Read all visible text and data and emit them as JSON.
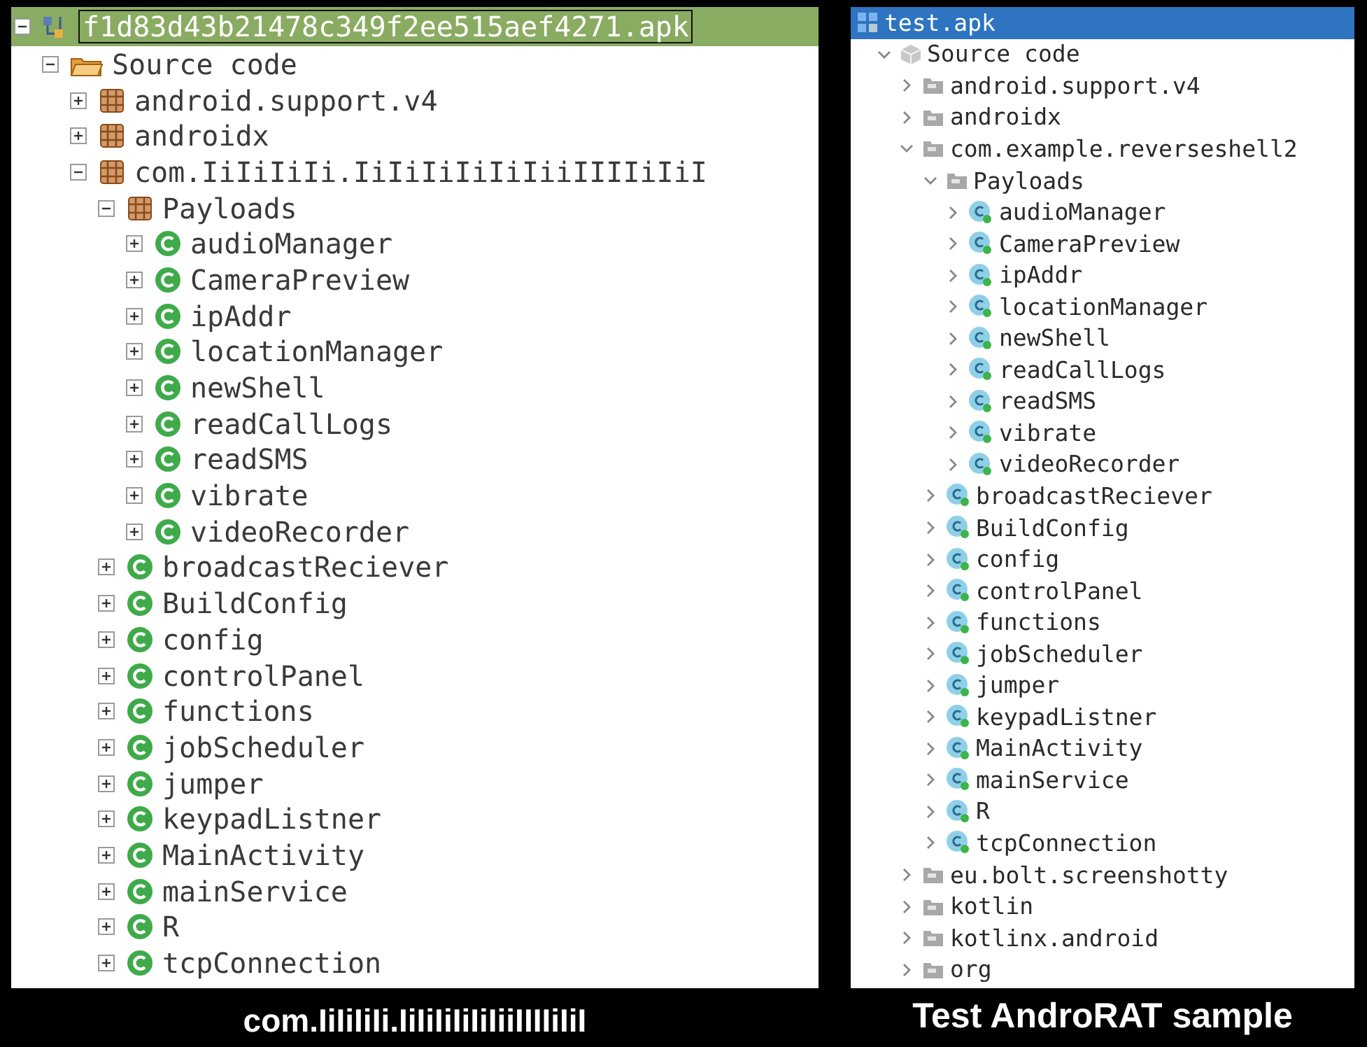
{
  "panels": [
    {
      "kind": "classic",
      "caption": "com.IiIiIiIi.IiIiIiIiIiIiiIIIIiIiI",
      "root": {
        "label": "f1d83d43b21478c349f2ee515aef4271.apk",
        "kind": "apk",
        "selected": true,
        "expanded": true,
        "children": [
          {
            "label": "Source code",
            "kind": "source",
            "selected": false,
            "expanded": true,
            "children": [
              {
                "label": "android.support.v4",
                "kind": "package",
                "selected": false,
                "expanded": false
              },
              {
                "label": "androidx",
                "kind": "package",
                "selected": false,
                "expanded": false
              },
              {
                "label": "com.IiIiIiIi.IiIiIiIiIiIiiIIIIiIiI",
                "kind": "package",
                "selected": false,
                "expanded": true,
                "children": [
                  {
                    "label": "Payloads",
                    "kind": "package",
                    "selected": false,
                    "expanded": true,
                    "children": [
                      {
                        "label": "audioManager",
                        "kind": "class",
                        "selected": false,
                        "expanded": false
                      },
                      {
                        "label": "CameraPreview",
                        "kind": "class",
                        "selected": false,
                        "expanded": false
                      },
                      {
                        "label": "ipAddr",
                        "kind": "class",
                        "selected": false,
                        "expanded": false
                      },
                      {
                        "label": "locationManager",
                        "kind": "class",
                        "selected": false,
                        "expanded": false
                      },
                      {
                        "label": "newShell",
                        "kind": "class",
                        "selected": false,
                        "expanded": false
                      },
                      {
                        "label": "readCallLogs",
                        "kind": "class",
                        "selected": false,
                        "expanded": false
                      },
                      {
                        "label": "readSMS",
                        "kind": "class",
                        "selected": false,
                        "expanded": false
                      },
                      {
                        "label": "vibrate",
                        "kind": "class",
                        "selected": false,
                        "expanded": false
                      },
                      {
                        "label": "videoRecorder",
                        "kind": "class",
                        "selected": false,
                        "expanded": false
                      }
                    ]
                  },
                  {
                    "label": "broadcastReciever",
                    "kind": "class",
                    "selected": false,
                    "expanded": false
                  },
                  {
                    "label": "BuildConfig",
                    "kind": "class",
                    "selected": false,
                    "expanded": false
                  },
                  {
                    "label": "config",
                    "kind": "class",
                    "selected": false,
                    "expanded": false
                  },
                  {
                    "label": "controlPanel",
                    "kind": "class",
                    "selected": false,
                    "expanded": false
                  },
                  {
                    "label": "functions",
                    "kind": "class",
                    "selected": false,
                    "expanded": false
                  },
                  {
                    "label": "jobScheduler",
                    "kind": "class",
                    "selected": false,
                    "expanded": false
                  },
                  {
                    "label": "jumper",
                    "kind": "class",
                    "selected": false,
                    "expanded": false
                  },
                  {
                    "label": "keypadListner",
                    "kind": "class",
                    "selected": false,
                    "expanded": false
                  },
                  {
                    "label": "MainActivity",
                    "kind": "class",
                    "selected": false,
                    "expanded": false
                  },
                  {
                    "label": "mainService",
                    "kind": "class",
                    "selected": false,
                    "expanded": false
                  },
                  {
                    "label": "R",
                    "kind": "class",
                    "selected": false,
                    "expanded": false
                  },
                  {
                    "label": "tcpConnection",
                    "kind": "class",
                    "selected": false,
                    "expanded": false
                  }
                ]
              }
            ]
          }
        ]
      }
    },
    {
      "kind": "flat",
      "caption": "Test AndroRAT sample",
      "root": {
        "label": "test.apk",
        "kind": "apk",
        "selected": true,
        "children": [
          {
            "label": "Source code",
            "kind": "source",
            "selected": false,
            "expanded": true,
            "children": [
              {
                "label": "android.support.v4",
                "kind": "package",
                "selected": false,
                "expanded": false
              },
              {
                "label": "androidx",
                "kind": "package",
                "selected": false,
                "expanded": false
              },
              {
                "label": "com.example.reverseshell2",
                "kind": "package",
                "selected": false,
                "expanded": true,
                "children": [
                  {
                    "label": "Payloads",
                    "kind": "package",
                    "selected": false,
                    "expanded": true,
                    "children": [
                      {
                        "label": "audioManager",
                        "kind": "class",
                        "selected": false,
                        "expanded": false
                      },
                      {
                        "label": "CameraPreview",
                        "kind": "class",
                        "selected": false,
                        "expanded": false
                      },
                      {
                        "label": "ipAddr",
                        "kind": "class",
                        "selected": false,
                        "expanded": false
                      },
                      {
                        "label": "locationManager",
                        "kind": "class",
                        "selected": false,
                        "expanded": false
                      },
                      {
                        "label": "newShell",
                        "kind": "class",
                        "selected": false,
                        "expanded": false
                      },
                      {
                        "label": "readCallLogs",
                        "kind": "class",
                        "selected": false,
                        "expanded": false
                      },
                      {
                        "label": "readSMS",
                        "kind": "class",
                        "selected": false,
                        "expanded": false
                      },
                      {
                        "label": "vibrate",
                        "kind": "class",
                        "selected": false,
                        "expanded": false
                      },
                      {
                        "label": "videoRecorder",
                        "kind": "class",
                        "selected": false,
                        "expanded": false
                      }
                    ]
                  },
                  {
                    "label": "broadcastReciever",
                    "kind": "class",
                    "selected": false,
                    "expanded": false
                  },
                  {
                    "label": "BuildConfig",
                    "kind": "class",
                    "selected": false,
                    "expanded": false
                  },
                  {
                    "label": "config",
                    "kind": "class",
                    "selected": false,
                    "expanded": false
                  },
                  {
                    "label": "controlPanel",
                    "kind": "class",
                    "selected": false,
                    "expanded": false
                  },
                  {
                    "label": "functions",
                    "kind": "class",
                    "selected": false,
                    "expanded": false
                  },
                  {
                    "label": "jobScheduler",
                    "kind": "class",
                    "selected": false,
                    "expanded": false
                  },
                  {
                    "label": "jumper",
                    "kind": "class",
                    "selected": false,
                    "expanded": false
                  },
                  {
                    "label": "keypadListner",
                    "kind": "class",
                    "selected": false,
                    "expanded": false
                  },
                  {
                    "label": "MainActivity",
                    "kind": "class",
                    "selected": false,
                    "expanded": false
                  },
                  {
                    "label": "mainService",
                    "kind": "class",
                    "selected": false,
                    "expanded": false
                  },
                  {
                    "label": "R",
                    "kind": "class",
                    "selected": false,
                    "expanded": false
                  },
                  {
                    "label": "tcpConnection",
                    "kind": "class",
                    "selected": false,
                    "expanded": false
                  }
                ]
              },
              {
                "label": "eu.bolt.screenshotty",
                "kind": "package",
                "selected": false,
                "expanded": false
              },
              {
                "label": "kotlin",
                "kind": "package",
                "selected": false,
                "expanded": false
              },
              {
                "label": "kotlinx.android",
                "kind": "package",
                "selected": false,
                "expanded": false
              },
              {
                "label": "org",
                "kind": "package",
                "selected": false,
                "expanded": false
              }
            ]
          }
        ]
      }
    }
  ]
}
